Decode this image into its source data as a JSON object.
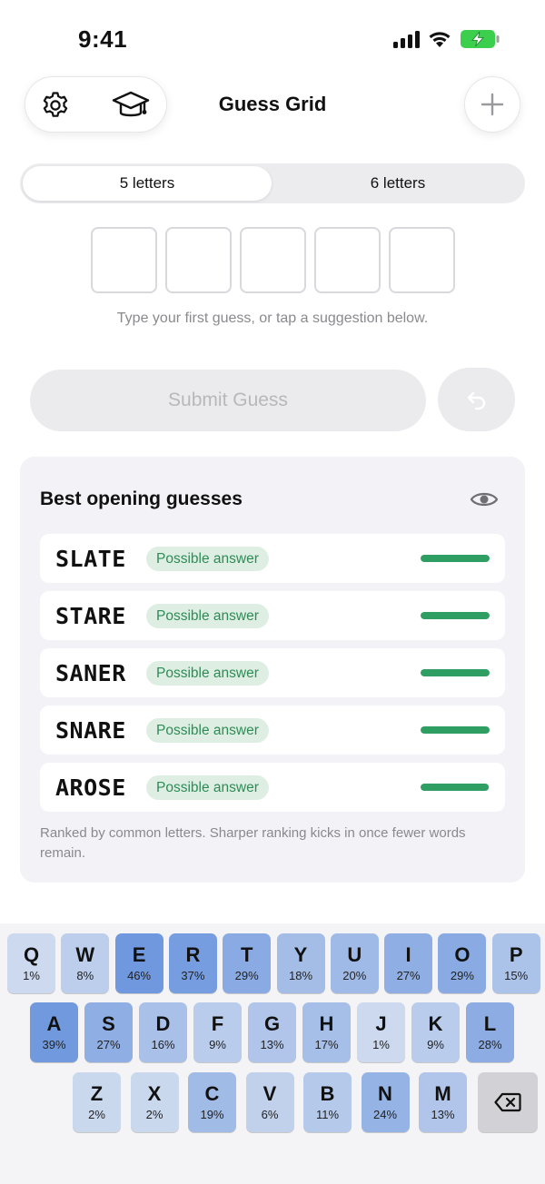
{
  "status_bar": {
    "time": "9:41"
  },
  "header": {
    "title": "Guess Grid"
  },
  "length_options": [
    {
      "label": "5 letters",
      "selected": true
    },
    {
      "label": "6 letters",
      "selected": false
    }
  ],
  "guess": {
    "hint": "Type your first guess, or tap a suggestion below.",
    "submit_label": "Submit Guess"
  },
  "suggestions": {
    "title": "Best opening guesses",
    "items": [
      {
        "word": "SLATE",
        "badge": "Possible answer",
        "score": 1.0
      },
      {
        "word": "STARE",
        "badge": "Possible answer",
        "score": 1.0
      },
      {
        "word": "SANER",
        "badge": "Possible answer",
        "score": 1.0
      },
      {
        "word": "SNARE",
        "badge": "Possible answer",
        "score": 1.0
      },
      {
        "word": "AROSE",
        "badge": "Possible answer",
        "score": 0.99
      }
    ],
    "footnote": "Ranked by common letters. Sharper ranking kicks in once fewer words remain."
  },
  "keyboard": {
    "rows": [
      [
        {
          "letter": "Q",
          "pct": "1%",
          "freq": 1
        },
        {
          "letter": "W",
          "pct": "8%",
          "freq": 8
        },
        {
          "letter": "E",
          "pct": "46%",
          "freq": 46
        },
        {
          "letter": "R",
          "pct": "37%",
          "freq": 37
        },
        {
          "letter": "T",
          "pct": "29%",
          "freq": 29
        },
        {
          "letter": "Y",
          "pct": "18%",
          "freq": 18
        },
        {
          "letter": "U",
          "pct": "20%",
          "freq": 20
        },
        {
          "letter": "I",
          "pct": "27%",
          "freq": 27
        },
        {
          "letter": "O",
          "pct": "29%",
          "freq": 29
        },
        {
          "letter": "P",
          "pct": "15%",
          "freq": 15
        }
      ],
      [
        {
          "letter": "A",
          "pct": "39%",
          "freq": 39
        },
        {
          "letter": "S",
          "pct": "27%",
          "freq": 27
        },
        {
          "letter": "D",
          "pct": "16%",
          "freq": 16
        },
        {
          "letter": "F",
          "pct": "9%",
          "freq": 9
        },
        {
          "letter": "G",
          "pct": "13%",
          "freq": 13
        },
        {
          "letter": "H",
          "pct": "17%",
          "freq": 17
        },
        {
          "letter": "J",
          "pct": "1%",
          "freq": 1
        },
        {
          "letter": "K",
          "pct": "9%",
          "freq": 9
        },
        {
          "letter": "L",
          "pct": "28%",
          "freq": 28
        }
      ],
      [
        {
          "letter": "Z",
          "pct": "2%",
          "freq": 2
        },
        {
          "letter": "X",
          "pct": "2%",
          "freq": 2
        },
        {
          "letter": "C",
          "pct": "19%",
          "freq": 19
        },
        {
          "letter": "V",
          "pct": "6%",
          "freq": 6
        },
        {
          "letter": "B",
          "pct": "11%",
          "freq": 11
        },
        {
          "letter": "N",
          "pct": "24%",
          "freq": 24
        },
        {
          "letter": "M",
          "pct": "13%",
          "freq": 13
        }
      ]
    ],
    "delete_icon": "backspace-icon"
  },
  "colors": {
    "accent_green": "#2f9e63",
    "badge_bg": "#dfeee3",
    "key_low": "#cfdbef",
    "key_high": "#6f98de",
    "battery_green": "#3ccf4e"
  },
  "icons": {
    "settings": "gear-icon",
    "learn": "graduation-cap-icon",
    "add": "plus-icon",
    "undo": "undo-icon",
    "visibility": "eye-icon"
  }
}
